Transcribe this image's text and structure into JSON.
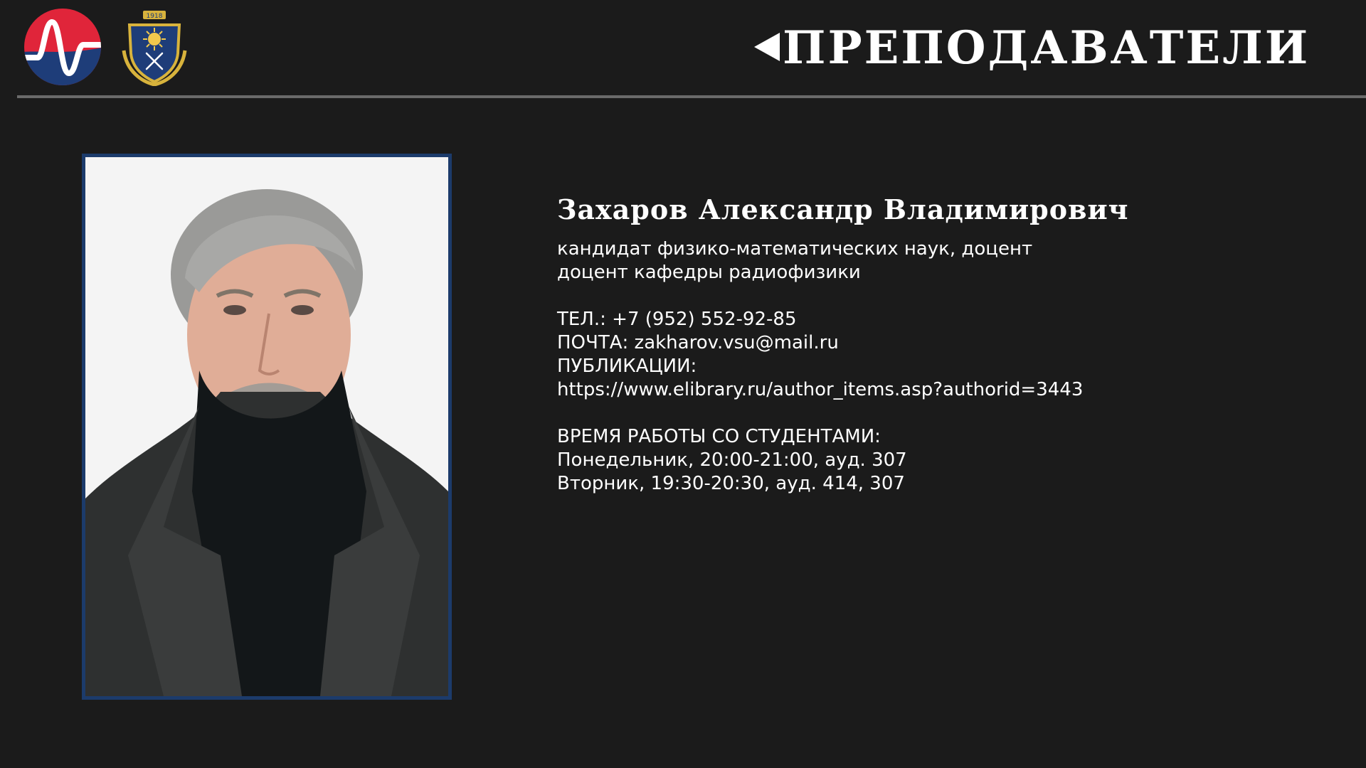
{
  "header": {
    "title": "ПРЕПОДАВАТЕЛИ",
    "back_icon": "triangle-left-icon",
    "logos": [
      "wave-logo",
      "university-crest-logo"
    ],
    "crest_year": "1918"
  },
  "teacher": {
    "name": "Захаров Александр Владимирович",
    "degree": "кандидат физико-математических наук, доцент",
    "position": "доцент кафедры радиофизики",
    "phone_label": "ТЕЛ.:",
    "phone": "+7 (952) 552-92-85",
    "email_label": "ПОЧТА:",
    "email": "zakharov.vsu@mail.ru",
    "publications_label": "ПУБЛИКАЦИИ:",
    "publications_url": "https://www.elibrary.ru/author_items.asp?authorid=3443",
    "hours_label": "ВРЕМЯ РАБОТЫ СО СТУДЕНТАМИ:",
    "hours": [
      "Понедельник, 20:00-21:00, ауд. 307",
      "Вторник, 19:30-20:30, ауд. 414, 307"
    ]
  },
  "colors": {
    "background": "#1b1b1b",
    "divider": "#6a6a6a",
    "photo_border": "#1c3b6b",
    "logo_red": "#e0253a",
    "logo_blue": "#1e3d79",
    "crest_gold": "#d8b33c"
  }
}
